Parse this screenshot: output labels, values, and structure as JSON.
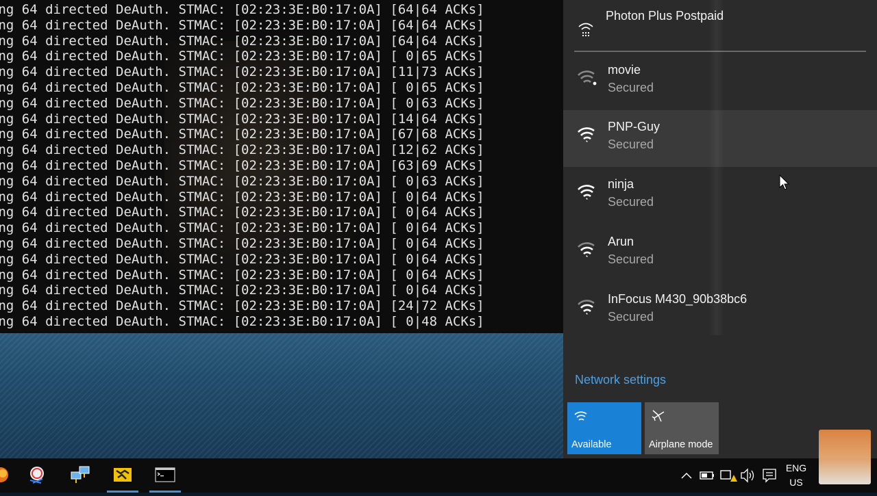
{
  "terminal": {
    "lines": [
      "ing 64 directed DeAuth. STMAC: [02:23:3E:B0:17:0A] [64|64 ACKs]",
      "ing 64 directed DeAuth. STMAC: [02:23:3E:B0:17:0A] [64|64 ACKs]",
      "ing 64 directed DeAuth. STMAC: [02:23:3E:B0:17:0A] [64|64 ACKs]",
      "ing 64 directed DeAuth. STMAC: [02:23:3E:B0:17:0A] [ 0|65 ACKs]",
      "ing 64 directed DeAuth. STMAC: [02:23:3E:B0:17:0A] [11|73 ACKs]",
      "ing 64 directed DeAuth. STMAC: [02:23:3E:B0:17:0A] [ 0|65 ACKs]",
      "ing 64 directed DeAuth. STMAC: [02:23:3E:B0:17:0A] [ 0|63 ACKs]",
      "ing 64 directed DeAuth. STMAC: [02:23:3E:B0:17:0A] [14|64 ACKs]",
      "ing 64 directed DeAuth. STMAC: [02:23:3E:B0:17:0A] [67|68 ACKs]",
      "ing 64 directed DeAuth. STMAC: [02:23:3E:B0:17:0A] [12|62 ACKs]",
      "ing 64 directed DeAuth. STMAC: [02:23:3E:B0:17:0A] [63|69 ACKs]",
      "ing 64 directed DeAuth. STMAC: [02:23:3E:B0:17:0A] [ 0|63 ACKs]",
      "ing 64 directed DeAuth. STMAC: [02:23:3E:B0:17:0A] [ 0|64 ACKs]",
      "ing 64 directed DeAuth. STMAC: [02:23:3E:B0:17:0A] [ 0|64 ACKs]",
      "ing 64 directed DeAuth. STMAC: [02:23:3E:B0:17:0A] [ 0|64 ACKs]",
      "ing 64 directed DeAuth. STMAC: [02:23:3E:B0:17:0A] [ 0|64 ACKs]",
      "ing 64 directed DeAuth. STMAC: [02:23:3E:B0:17:0A] [ 0|64 ACKs]",
      "ing 64 directed DeAuth. STMAC: [02:23:3E:B0:17:0A] [ 0|64 ACKs]",
      "ing 64 directed DeAuth. STMAC: [02:23:3E:B0:17:0A] [ 0|64 ACKs]",
      "ing 64 directed DeAuth. STMAC: [02:23:3E:B0:17:0A] [24|72 ACKs]",
      "ing 64 directed DeAuth. STMAC: [02:23:3E:B0:17:0A] [ 0|48 ACKs]"
    ]
  },
  "flyout": {
    "connected": {
      "name": "Photon Plus Postpaid",
      "icon": "cellular-network-icon"
    },
    "networks": [
      {
        "ssid": "movie",
        "status": "Secured",
        "icon": "wifi-icon"
      },
      {
        "ssid": "PNP-Guy",
        "status": "Secured",
        "icon": "wifi-icon"
      },
      {
        "ssid": "ninja",
        "status": "Secured",
        "icon": "wifi-icon"
      },
      {
        "ssid": "Arun",
        "status": "Secured",
        "icon": "wifi-icon"
      },
      {
        "ssid": "InFocus M430_90b38bc6",
        "status": "Secured",
        "icon": "wifi-icon"
      }
    ],
    "network_settings_label": "Network settings",
    "quick_actions": [
      {
        "label": "Available",
        "icon": "wifi-icon",
        "state": "on"
      },
      {
        "label": "Airplane mode",
        "icon": "airplane-icon",
        "state": "off"
      }
    ]
  },
  "taskbar": {
    "apps": [
      "firefox-icon",
      "network-tool-icon",
      "remote-desktop-icon",
      "virtualbox-icon",
      "command-prompt-icon"
    ],
    "tray_icons": [
      "chevron-up-icon",
      "battery-icon",
      "network-warning-icon",
      "volume-icon",
      "action-center-icon"
    ],
    "language_top": "ENG",
    "language_bottom": "US"
  },
  "colors": {
    "accent": "#1a82d6",
    "link": "#4aa0e6",
    "flyout_bg": "#2b2b2b",
    "terminal_bg": "#0d0d0d"
  }
}
